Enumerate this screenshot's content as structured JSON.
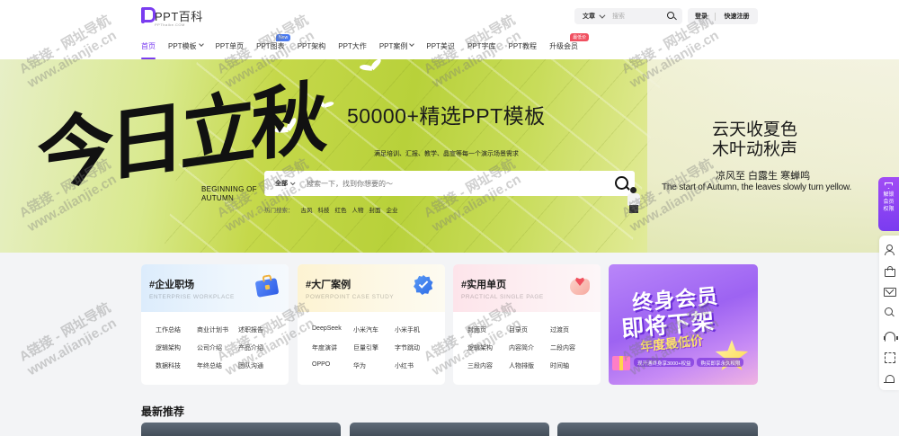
{
  "header": {
    "logo_text": "PPT百科",
    "logo_sub": "PPTbaike.COM",
    "search_type": "文章",
    "search_placeholder": "搜索",
    "login": "登录",
    "register": "快速注册"
  },
  "nav": [
    {
      "label": "首页"
    },
    {
      "label": "PPT模板"
    },
    {
      "label": "PPT单页"
    },
    {
      "label": "PPT图表"
    },
    {
      "label": "PPT架构"
    },
    {
      "label": "PPT大作"
    },
    {
      "label": "PPT案例"
    },
    {
      "label": "PPT美识"
    },
    {
      "label": "PPT字库"
    },
    {
      "label": "PPT教程"
    },
    {
      "label": "升级会员"
    }
  ],
  "nav_badges": {
    "new": "New",
    "hot": "最低价"
  },
  "banner": {
    "calligraphy": "今日立秋",
    "calligraphy_en_line1": "BEGINNING OF",
    "calligraphy_en_line2": "AUTUMN",
    "title": "50000+精选PPT模板",
    "subtitle": "满足培训、汇报、教学、晶宣等每一个演示场景需求",
    "search_type": "全部",
    "search_placeholder": "搜索一下，找到你想要的～",
    "hot_label": "热门搜索：",
    "hot_tags": [
      "古风",
      "科技",
      "红色",
      "人物",
      "封面",
      "企业"
    ],
    "poem_line1": "云天收夏色",
    "poem_line2": "木叶动秋声",
    "poem_line3": "凉风至 白露生 寒蝉鸣",
    "poem_en": "The start of Autumn, the leaves slowly turn yellow."
  },
  "sidebar": {
    "vip_label": "解锁会员权限"
  },
  "cards": [
    {
      "title": "#企业职场",
      "en": "ENTERPRISE WORKPLACE",
      "items": [
        "工作总结",
        "商业计划书",
        "述职报告",
        "逻辑架构",
        "公司介绍",
        "产品介绍",
        "数据科技",
        "年终总结",
        "团队沟通"
      ]
    },
    {
      "title": "#大厂案例",
      "en": "POWERPOINT CASE STUDY",
      "items": [
        "DeepSeek",
        "小米汽车",
        "小米手机",
        "年度演讲",
        "巨量引擎",
        "字节跳动",
        "OPPO",
        "华为",
        "小红书"
      ]
    },
    {
      "title": "#实用单页",
      "en": "PRACTICAL SINGLE PAGE",
      "items": [
        "封面页",
        "目录页",
        "过渡页",
        "逻辑架构",
        "内容简介",
        "二段内容",
        "三段内容",
        "人物排版",
        "时间轴"
      ]
    }
  ],
  "promo": {
    "line1": "终身会员",
    "line2": "即将下架",
    "line3": "年度最低价",
    "caption1": "现开通终身享3000+权益",
    "caption2": "购买即享永久权限"
  },
  "latest": {
    "title": "最新推荐"
  },
  "watermark": {
    "line1": "A链接 - 网址导航",
    "line2": "www.alianjie.cn"
  },
  "colors": {
    "accent": "#7a3cf0",
    "new_badge": "#4a7af0",
    "hot_badge": "#f05060"
  }
}
